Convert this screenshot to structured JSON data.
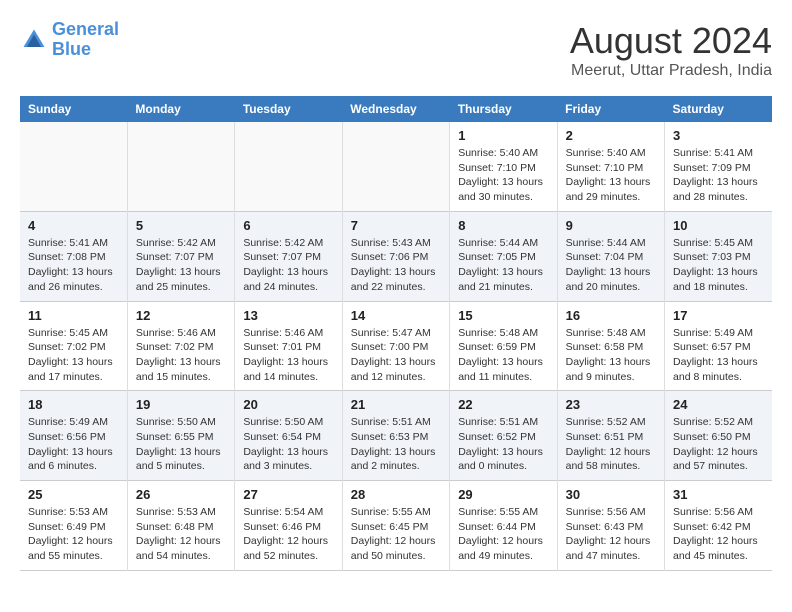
{
  "header": {
    "logo_line1": "General",
    "logo_line2": "Blue",
    "title": "August 2024",
    "subtitle": "Meerut, Uttar Pradesh, India"
  },
  "weekdays": [
    "Sunday",
    "Monday",
    "Tuesday",
    "Wednesday",
    "Thursday",
    "Friday",
    "Saturday"
  ],
  "weeks": [
    [
      {
        "day": "",
        "info": ""
      },
      {
        "day": "",
        "info": ""
      },
      {
        "day": "",
        "info": ""
      },
      {
        "day": "",
        "info": ""
      },
      {
        "day": "1",
        "info": "Sunrise: 5:40 AM\nSunset: 7:10 PM\nDaylight: 13 hours\nand 30 minutes."
      },
      {
        "day": "2",
        "info": "Sunrise: 5:40 AM\nSunset: 7:10 PM\nDaylight: 13 hours\nand 29 minutes."
      },
      {
        "day": "3",
        "info": "Sunrise: 5:41 AM\nSunset: 7:09 PM\nDaylight: 13 hours\nand 28 minutes."
      }
    ],
    [
      {
        "day": "4",
        "info": "Sunrise: 5:41 AM\nSunset: 7:08 PM\nDaylight: 13 hours\nand 26 minutes."
      },
      {
        "day": "5",
        "info": "Sunrise: 5:42 AM\nSunset: 7:07 PM\nDaylight: 13 hours\nand 25 minutes."
      },
      {
        "day": "6",
        "info": "Sunrise: 5:42 AM\nSunset: 7:07 PM\nDaylight: 13 hours\nand 24 minutes."
      },
      {
        "day": "7",
        "info": "Sunrise: 5:43 AM\nSunset: 7:06 PM\nDaylight: 13 hours\nand 22 minutes."
      },
      {
        "day": "8",
        "info": "Sunrise: 5:44 AM\nSunset: 7:05 PM\nDaylight: 13 hours\nand 21 minutes."
      },
      {
        "day": "9",
        "info": "Sunrise: 5:44 AM\nSunset: 7:04 PM\nDaylight: 13 hours\nand 20 minutes."
      },
      {
        "day": "10",
        "info": "Sunrise: 5:45 AM\nSunset: 7:03 PM\nDaylight: 13 hours\nand 18 minutes."
      }
    ],
    [
      {
        "day": "11",
        "info": "Sunrise: 5:45 AM\nSunset: 7:02 PM\nDaylight: 13 hours\nand 17 minutes."
      },
      {
        "day": "12",
        "info": "Sunrise: 5:46 AM\nSunset: 7:02 PM\nDaylight: 13 hours\nand 15 minutes."
      },
      {
        "day": "13",
        "info": "Sunrise: 5:46 AM\nSunset: 7:01 PM\nDaylight: 13 hours\nand 14 minutes."
      },
      {
        "day": "14",
        "info": "Sunrise: 5:47 AM\nSunset: 7:00 PM\nDaylight: 13 hours\nand 12 minutes."
      },
      {
        "day": "15",
        "info": "Sunrise: 5:48 AM\nSunset: 6:59 PM\nDaylight: 13 hours\nand 11 minutes."
      },
      {
        "day": "16",
        "info": "Sunrise: 5:48 AM\nSunset: 6:58 PM\nDaylight: 13 hours\nand 9 minutes."
      },
      {
        "day": "17",
        "info": "Sunrise: 5:49 AM\nSunset: 6:57 PM\nDaylight: 13 hours\nand 8 minutes."
      }
    ],
    [
      {
        "day": "18",
        "info": "Sunrise: 5:49 AM\nSunset: 6:56 PM\nDaylight: 13 hours\nand 6 minutes."
      },
      {
        "day": "19",
        "info": "Sunrise: 5:50 AM\nSunset: 6:55 PM\nDaylight: 13 hours\nand 5 minutes."
      },
      {
        "day": "20",
        "info": "Sunrise: 5:50 AM\nSunset: 6:54 PM\nDaylight: 13 hours\nand 3 minutes."
      },
      {
        "day": "21",
        "info": "Sunrise: 5:51 AM\nSunset: 6:53 PM\nDaylight: 13 hours\nand 2 minutes."
      },
      {
        "day": "22",
        "info": "Sunrise: 5:51 AM\nSunset: 6:52 PM\nDaylight: 13 hours\nand 0 minutes."
      },
      {
        "day": "23",
        "info": "Sunrise: 5:52 AM\nSunset: 6:51 PM\nDaylight: 12 hours\nand 58 minutes."
      },
      {
        "day": "24",
        "info": "Sunrise: 5:52 AM\nSunset: 6:50 PM\nDaylight: 12 hours\nand 57 minutes."
      }
    ],
    [
      {
        "day": "25",
        "info": "Sunrise: 5:53 AM\nSunset: 6:49 PM\nDaylight: 12 hours\nand 55 minutes."
      },
      {
        "day": "26",
        "info": "Sunrise: 5:53 AM\nSunset: 6:48 PM\nDaylight: 12 hours\nand 54 minutes."
      },
      {
        "day": "27",
        "info": "Sunrise: 5:54 AM\nSunset: 6:46 PM\nDaylight: 12 hours\nand 52 minutes."
      },
      {
        "day": "28",
        "info": "Sunrise: 5:55 AM\nSunset: 6:45 PM\nDaylight: 12 hours\nand 50 minutes."
      },
      {
        "day": "29",
        "info": "Sunrise: 5:55 AM\nSunset: 6:44 PM\nDaylight: 12 hours\nand 49 minutes."
      },
      {
        "day": "30",
        "info": "Sunrise: 5:56 AM\nSunset: 6:43 PM\nDaylight: 12 hours\nand 47 minutes."
      },
      {
        "day": "31",
        "info": "Sunrise: 5:56 AM\nSunset: 6:42 PM\nDaylight: 12 hours\nand 45 minutes."
      }
    ]
  ]
}
